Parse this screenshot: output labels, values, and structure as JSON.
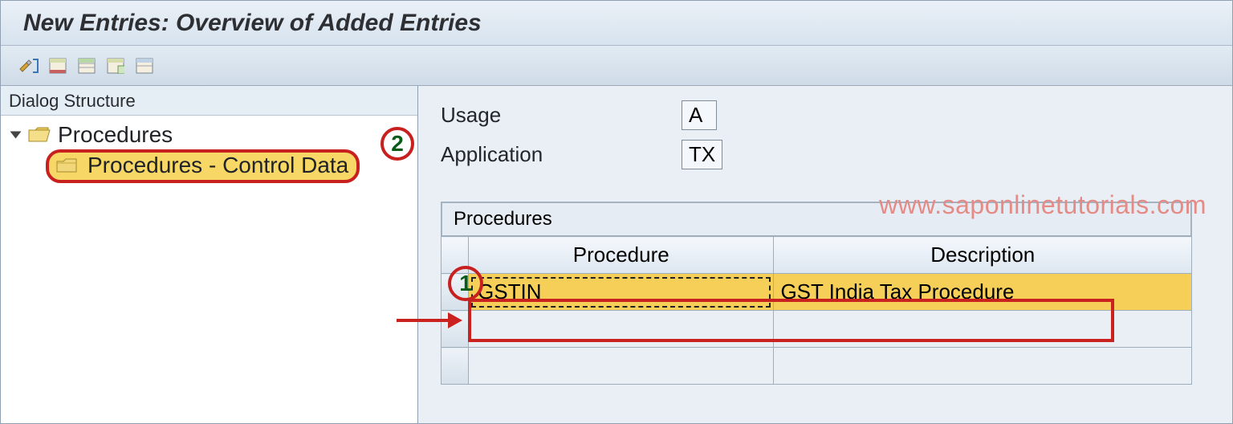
{
  "title": "New Entries: Overview of Added Entries",
  "sidebar": {
    "header": "Dialog Structure",
    "root": {
      "label": "Procedures"
    },
    "child": {
      "label": "Procedures - Control Data"
    }
  },
  "fields": {
    "usage": {
      "label": "Usage",
      "value": "A"
    },
    "application": {
      "label": "Application",
      "value": "TX"
    }
  },
  "table": {
    "title": "Procedures",
    "columns": {
      "procedure": "Procedure",
      "description": "Description"
    },
    "row": {
      "procedure": "GSTIN",
      "description": "GST India Tax Procedure"
    }
  },
  "watermark": "www.saponlinetutorials.com",
  "annotations": {
    "one": "1",
    "two": "2"
  },
  "icons": {
    "folder_open": "folder-open-icon",
    "folder_closed": "folder-closed-icon"
  }
}
